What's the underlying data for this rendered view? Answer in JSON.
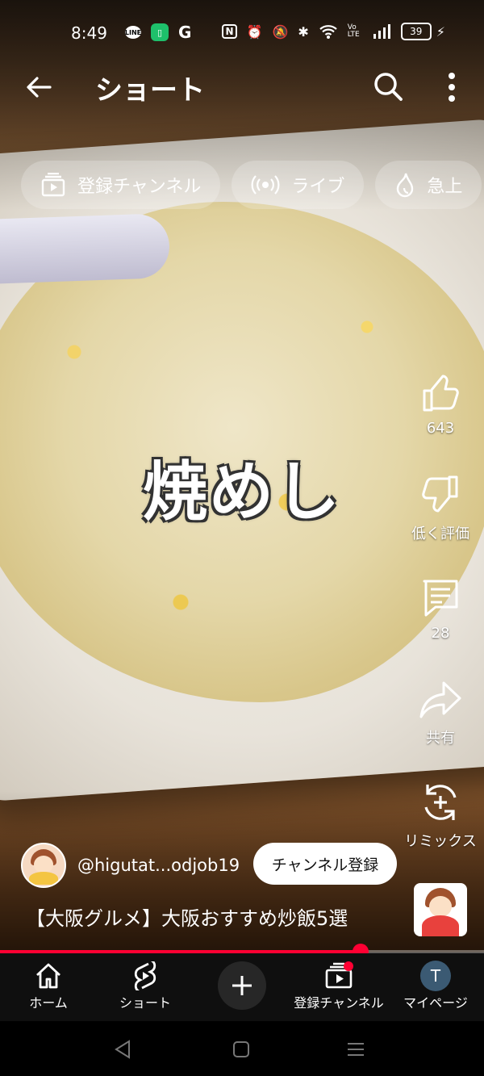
{
  "status_bar": {
    "time": "8:49",
    "left_icons": [
      "line-icon",
      "green-app-icon",
      "google-icon"
    ],
    "right_icons": [
      "nfc-icon",
      "alarm-icon",
      "mute-icon",
      "bluetooth-icon",
      "wifi-icon",
      "volte-icon",
      "signal-icon"
    ],
    "battery": "39",
    "volte_label": "Vo LTE"
  },
  "header": {
    "title": "ショート"
  },
  "chips": [
    {
      "label": "登録チャンネル",
      "icon": "subscriptions-icon"
    },
    {
      "label": "ライブ",
      "icon": "live-icon"
    },
    {
      "label": "急上",
      "icon": "trending-icon"
    }
  ],
  "video": {
    "overlay_text": "焼めし",
    "channel_handle": "@higutat...odjob19",
    "subscribe_label": "チャンネル登録",
    "title": "【大阪グルメ】大阪おすすめ炒飯5選",
    "progress": 0.745
  },
  "actions": {
    "like_count": "643",
    "dislike_label": "低く評価",
    "comment_count": "28",
    "share_label": "共有",
    "remix_label": "リミックス"
  },
  "bottom_nav": {
    "home": "ホーム",
    "shorts": "ショート",
    "subscriptions": "登録チャンネル",
    "me": "マイページ",
    "me_initial": "T"
  },
  "colors": {
    "accent": "#ff0033",
    "nav_bg": "#0f0f0f"
  }
}
